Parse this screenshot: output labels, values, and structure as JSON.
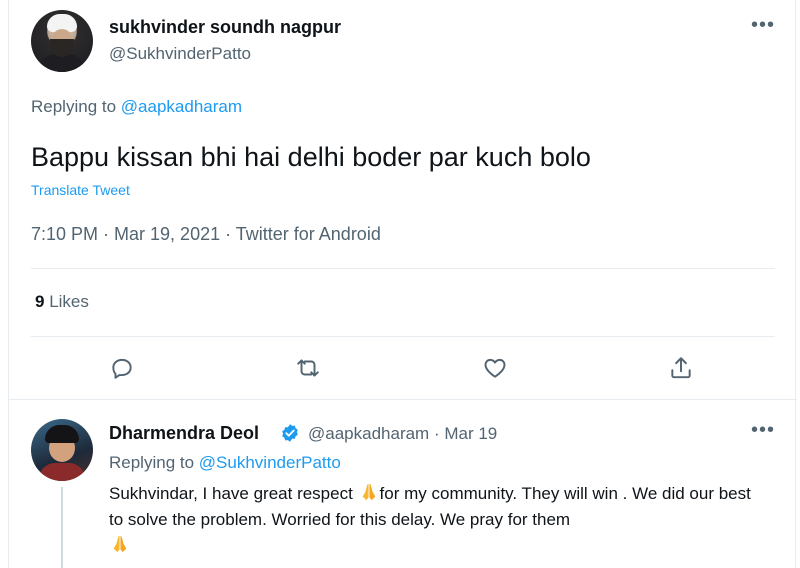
{
  "main_tweet": {
    "author_name": "sukhvinder soundh nagpur",
    "author_handle": "@SukhvinderPatto",
    "more_icon": "more-horizontal-icon",
    "replying_prefix": "Replying to",
    "replying_handle": "@aapkadharam",
    "text": "Bappu kissan bhi hai delhi boder par kuch bolo",
    "translate_label": "Translate Tweet",
    "meta": "7:10 PM · Mar 19, 2021 · Twitter for Android",
    "likes_count": "9",
    "likes_label": "Likes",
    "actions": [
      "reply-icon",
      "retweet-icon",
      "like-icon",
      "share-icon"
    ]
  },
  "reply_tweet": {
    "author_name": "Dharmendra Deol",
    "verified_icon": "verified-badge-icon",
    "handle_time": "@aapkadharam · Mar 19",
    "replying_prefix": "Replying to",
    "replying_handle": "@SukhvinderPatto",
    "text_part1": "Sukhvindar, I have great respect ",
    "text_part2": "for my  community. They will win . We did our best to solve the problem. Worried for this delay. We pray for them",
    "emoji_icon": "folded-hands-icon"
  },
  "colors": {
    "accent": "#1d9bf0",
    "muted": "#536471",
    "text": "#0f1419",
    "border": "#e6ecf0"
  }
}
